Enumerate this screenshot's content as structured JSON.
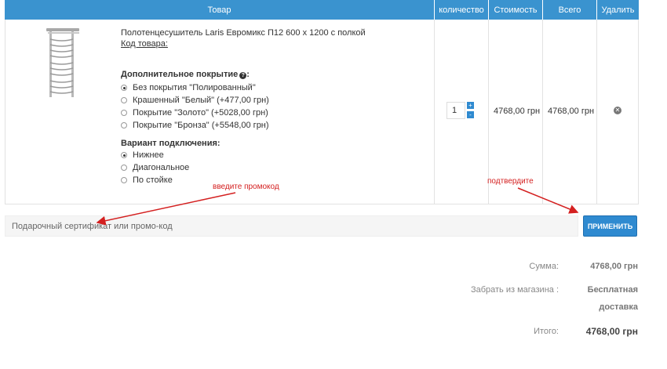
{
  "header": {
    "product": "Товар",
    "quantity": "количество",
    "price": "Стоимость",
    "total": "Всего",
    "remove": "Удалить"
  },
  "item": {
    "title": "Полотенцесушитель Laris Евромикс П12 600 х 1200 с полкой",
    "sku_label": "Код товара:",
    "option1": {
      "title": "Дополнительное покрытие",
      "help_icon": "question-circle-icon",
      "choices": [
        {
          "label": "Без покрытия \"Полированный\"",
          "checked": true
        },
        {
          "label": "Крашенный \"Белый\" (+477,00 грн)",
          "checked": false
        },
        {
          "label": "Покрытие \"Золото\" (+5028,00 грн)",
          "checked": false
        },
        {
          "label": "Покрытие \"Бронза\" (+5548,00 грн)",
          "checked": false
        }
      ]
    },
    "option2": {
      "title": "Вариант подключения:",
      "choices": [
        {
          "label": "Нижнее",
          "checked": true
        },
        {
          "label": "Диагональное",
          "checked": false
        },
        {
          "label": "По стойке",
          "checked": false
        }
      ]
    },
    "quantity": "1",
    "qty_plus": "+",
    "qty_minus": "-",
    "price": "4768,00 грн",
    "total": "4768,00 грн",
    "remove_icon": "remove-circle-icon"
  },
  "annotations": {
    "promo_hint": "введите промокод",
    "confirm_hint": "подтвердите"
  },
  "promo": {
    "placeholder": "Подарочный сертификат или промо-код",
    "apply_label": "ПРИМЕНИТЬ"
  },
  "totals": {
    "subtotal_label": "Сумма:",
    "subtotal_value": "4768,00 грн",
    "shipping_label": "Забрать из магазина :",
    "shipping_value_line1": "Бесплатная",
    "shipping_value_line2": "доставка",
    "total_label": "Итого:",
    "total_value": "4768,00 грн"
  },
  "colors": {
    "header_bg": "#3a93cf",
    "button_bg": "#2f8ad0",
    "annotation": "#d42020"
  }
}
